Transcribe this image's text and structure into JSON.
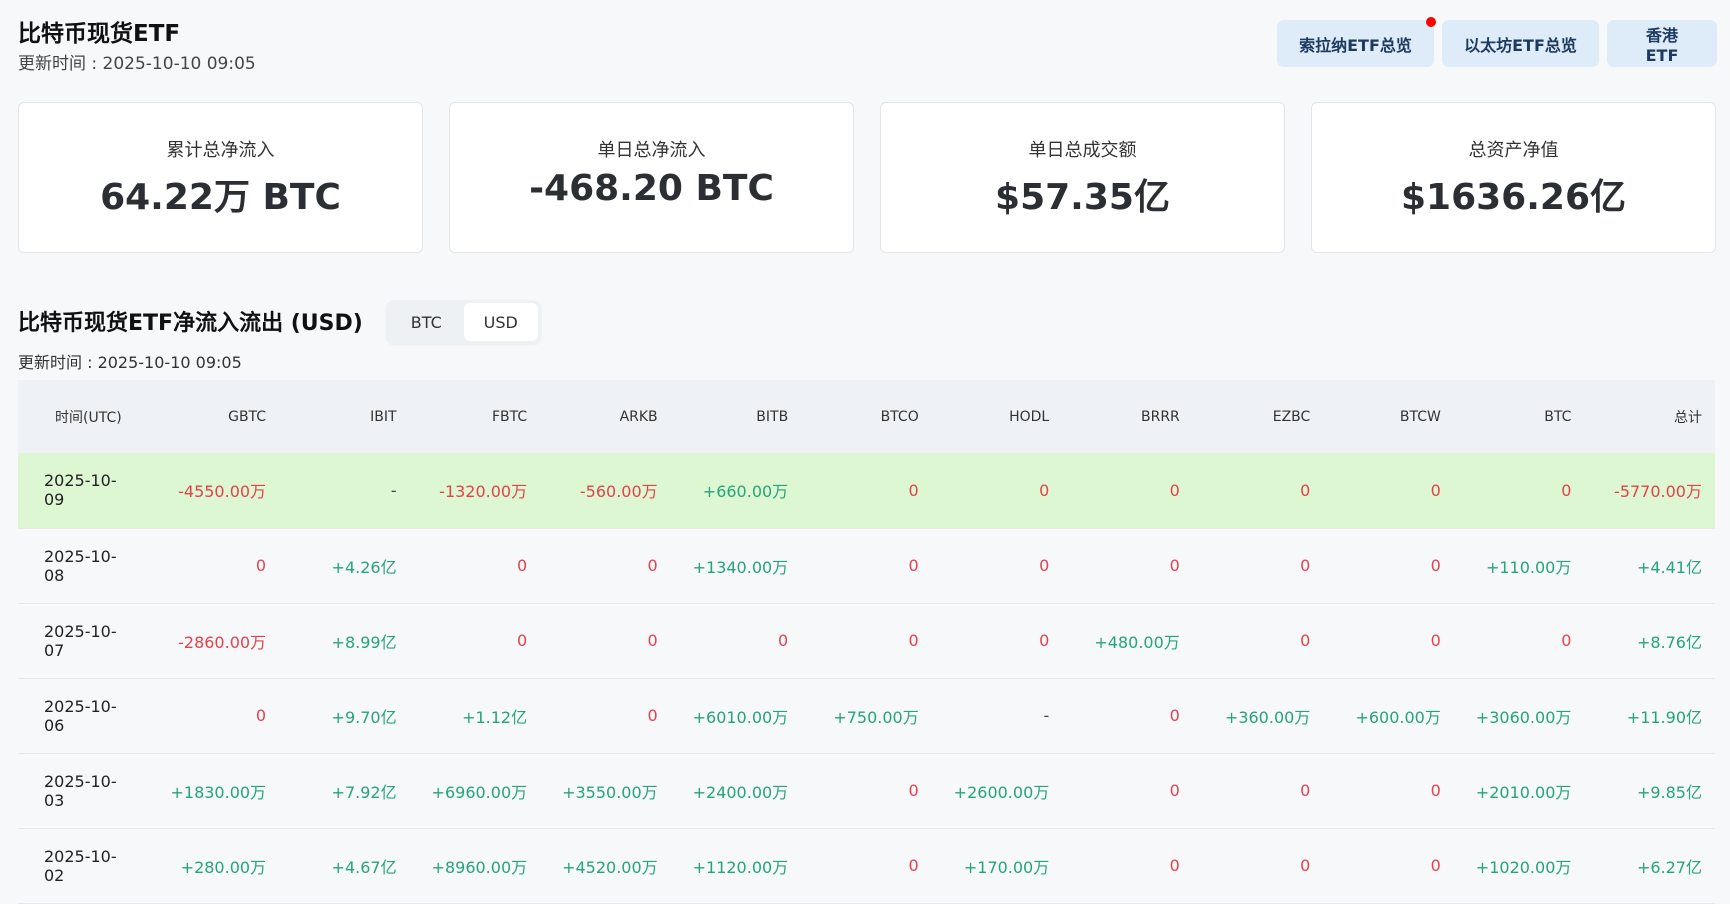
{
  "header": {
    "title": "比特币现货ETF",
    "updated": "更新时间 : 2025-10-10 09:05",
    "nav_buttons": [
      "索拉纳ETF总览",
      "以太坊ETF总览",
      "香港 ETF"
    ]
  },
  "cards": [
    {
      "label": "累计总净流入",
      "value": "64.22万 BTC"
    },
    {
      "label": "单日总净流入",
      "value": "-468.20 BTC"
    },
    {
      "label": "单日总成交额",
      "value": "$57.35亿"
    },
    {
      "label": "总资产净值",
      "value": "$1636.26亿"
    }
  ],
  "section": {
    "title": "比特币现货ETF净流入流出 (USD)",
    "toggle": [
      "BTC",
      "USD"
    ],
    "toggle_active": "USD",
    "updated": "更新时间 : 2025-10-10 09:05"
  },
  "colors": {
    "positive": "#25a47a",
    "negative": "#e5414d",
    "highlight": "#dcf7d2"
  },
  "table": {
    "columns": [
      "时间(UTC)",
      "GBTC",
      "IBIT",
      "FBTC",
      "ARKB",
      "BITB",
      "BTCO",
      "HODL",
      "BRRR",
      "EZBC",
      "BTCW",
      "BTC",
      "总计"
    ],
    "rows": [
      [
        "2025-10-09",
        "-4550.00万",
        "-",
        "-1320.00万",
        "-560.00万",
        "+660.00万",
        "0",
        "0",
        "0",
        "0",
        "0",
        "0",
        "-5770.00万"
      ],
      [
        "2025-10-08",
        "0",
        "+4.26亿",
        "0",
        "0",
        "+1340.00万",
        "0",
        "0",
        "0",
        "0",
        "0",
        "+110.00万",
        "+4.41亿"
      ],
      [
        "2025-10-07",
        "-2860.00万",
        "+8.99亿",
        "0",
        "0",
        "0",
        "0",
        "0",
        "+480.00万",
        "0",
        "0",
        "0",
        "+8.76亿"
      ],
      [
        "2025-10-06",
        "0",
        "+9.70亿",
        "+1.12亿",
        "0",
        "+6010.00万",
        "+750.00万",
        "-",
        "0",
        "+360.00万",
        "+600.00万",
        "+3060.00万",
        "+11.90亿"
      ],
      [
        "2025-10-03",
        "+1830.00万",
        "+7.92亿",
        "+6960.00万",
        "+3550.00万",
        "+2400.00万",
        "0",
        "+2600.00万",
        "0",
        "0",
        "0",
        "+2010.00万",
        "+9.85亿"
      ],
      [
        "2025-10-02",
        "+280.00万",
        "+4.67亿",
        "+8960.00万",
        "+4520.00万",
        "+1120.00万",
        "0",
        "+170.00万",
        "0",
        "0",
        "0",
        "+1020.00万",
        "+6.27亿"
      ]
    ]
  }
}
